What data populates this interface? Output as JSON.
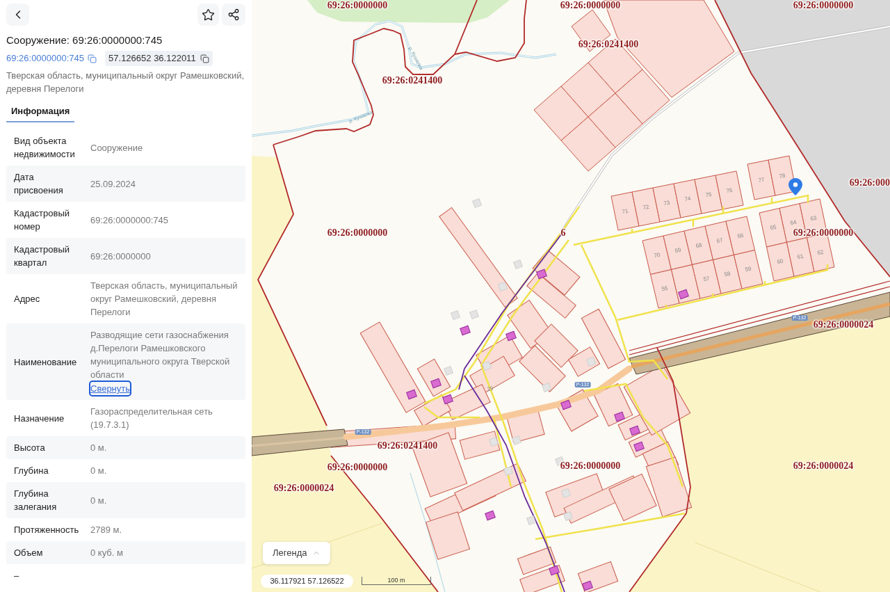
{
  "object": {
    "title": "Сооружение: 69:26:0000000:745",
    "cadastral_number": "69:26:0000000:745",
    "coordinates": "57.126652 36.122011",
    "address": "Тверская область, муниципальный округ Рамешковский, деревня Перелоги"
  },
  "tabs": [
    {
      "label": "Информация",
      "selected": true
    }
  ],
  "properties": [
    {
      "label": "Вид объекта недвижимости",
      "value": "Сооружение"
    },
    {
      "label": "Дата присвоения",
      "value": "25.09.2024"
    },
    {
      "label": "Кадастровый номер",
      "value": "69:26:0000000:745"
    },
    {
      "label": "Кадастровый квартал",
      "value": "69:26:0000000"
    },
    {
      "label": "Адрес",
      "value": "Тверская область, муниципальный округ Рамешковский, деревня Перелоги"
    },
    {
      "label": "Наименование",
      "value": "Разводящие сети газоснабжения д.Перелоги Рамешковского муниципального округа Тверской области",
      "link": {
        "label": "Свернуть",
        "focused": true
      }
    },
    {
      "label": "Назначение",
      "value": "Газораспределительная сеть (19.7.3.1)"
    },
    {
      "label": "Высота",
      "value": "0 м."
    },
    {
      "label": "Глубина",
      "value": "0 м."
    },
    {
      "label": "Глубина залегания",
      "value": "0 м."
    },
    {
      "label": "Протяженность",
      "value": "2789 м."
    },
    {
      "label": "Объем",
      "value": "0 куб. м"
    },
    {
      "label": "–"
    }
  ],
  "map": {
    "quarter_labels": [
      "69:26:0000000",
      "69:26:0000000",
      "69:26:0000000",
      "69:26:0241400",
      "69:26:0241400",
      "69:26:000",
      "69:26:0000000",
      "6",
      "69:26:0000000",
      "69:26:0000024",
      "69:26:0241400",
      "69:26:0000000",
      "69:26:0000000",
      "69:26:0000024",
      "69:26:0000024"
    ],
    "river_labels": [
      "р. Кушалка",
      "р. Кушалка"
    ],
    "road_labels": [
      "Р-132",
      "Р-132",
      "Р-132"
    ],
    "lot_numbers": [
      "71",
      "72",
      "73",
      "74",
      "75",
      "76",
      "77",
      "78",
      "70",
      "69",
      "68",
      "67",
      "66",
      "55",
      "57",
      "58",
      "59",
      "65",
      "64",
      "63",
      "60",
      "61",
      "62",
      "29"
    ],
    "legend_button": "Легенда",
    "cursor_coordinates": "36.117921 57.126522",
    "scale_label": "100 m"
  }
}
